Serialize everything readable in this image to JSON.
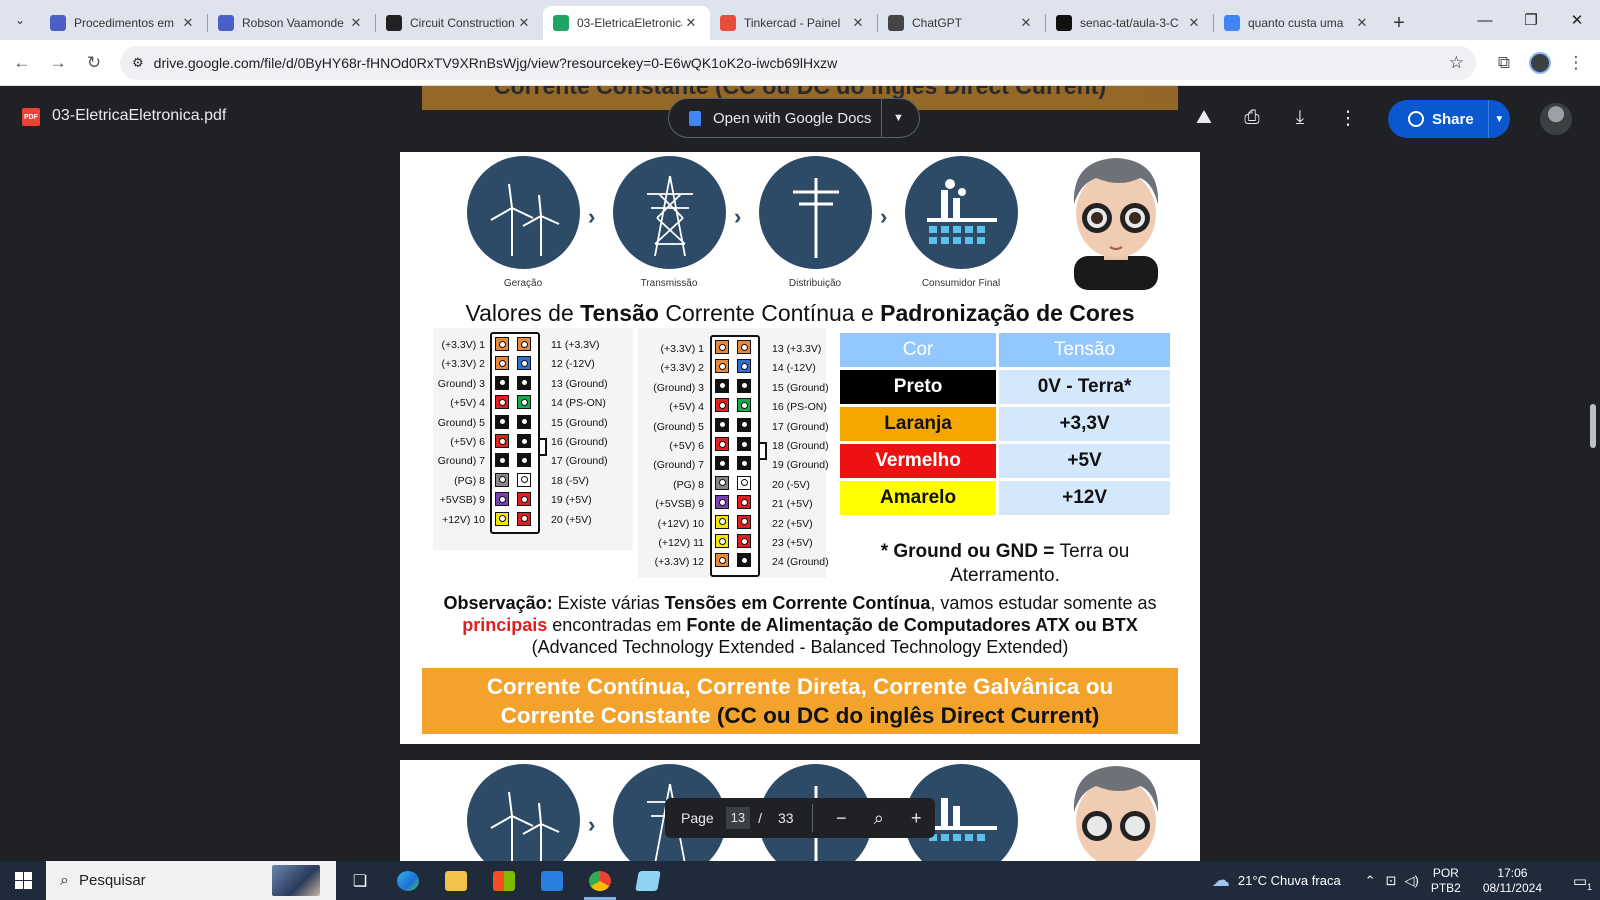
{
  "tabs": [
    {
      "title": "Procedimentos em",
      "icon": "google-forms-icon",
      "color": "#4b5fc9",
      "active": false
    },
    {
      "title": "Robson Vaamonde",
      "icon": "google-forms-icon",
      "color": "#4b5fc9",
      "active": false
    },
    {
      "title": "Circuit Construction",
      "icon": "phet-icon",
      "color": "#222222",
      "active": false
    },
    {
      "title": "03-EletricaEletronica",
      "icon": "google-drive-icon",
      "color": "#1fa463",
      "active": true
    },
    {
      "title": "Tinkercad - Painel",
      "icon": "tinkercad-icon",
      "color": "#e84d3d",
      "active": false
    },
    {
      "title": "ChatGPT",
      "icon": "chatgpt-icon",
      "color": "#444444",
      "active": false
    },
    {
      "title": "senac-tat/aula-3-C",
      "icon": "github-icon",
      "color": "#111111",
      "active": false
    },
    {
      "title": "quanto custa uma",
      "icon": "google-search-icon",
      "color": "#4285f4",
      "active": false
    }
  ],
  "url": "drive.google.com/file/d/0ByHY68r-fHNOd0RxTV9XRnBsWjg/view?resourcekey=0-E6wQK1oK2o-iwcb69lHxzw",
  "viewer": {
    "filename": "03-EletricaEletronica.pdf",
    "open_with": "Open with Google Docs",
    "share": "Share",
    "page_label": "Page",
    "page_current": "13",
    "page_sep": "/",
    "page_total": "33"
  },
  "pdf": {
    "prev_band": "Corrente Constante (CC ou DC do inglês Direct Current)",
    "icons": [
      {
        "label": "Geração",
        "icon": "wind-turbine-icon"
      },
      {
        "label": "Transmissão",
        "icon": "transmission-tower-icon"
      },
      {
        "label": "Distribuição",
        "icon": "utility-pole-icon"
      },
      {
        "label": "Consumidor Final",
        "icon": "factory-icon"
      }
    ],
    "title_1": "Valores de ",
    "title_2": "Tensão",
    "title_3": " Corrente Contínua e ",
    "title_4": "Padronização de Cores",
    "pins20_left": [
      "(+3.3V)  1",
      "(+3.3V)  2",
      "Ground)  3",
      "(+5V)  4",
      "Ground)  5",
      "(+5V)  6",
      "Ground)  7",
      "(PG)  8",
      "+5VSB)  9",
      "+12V)  10"
    ],
    "pins20_right": [
      "11  (+3.3V)",
      "12  (-12V)",
      "13  (Ground)",
      "14  (PS-ON)",
      "15  (Ground)",
      "16  (Ground)",
      "17  (Ground)",
      "18  (-5V)",
      "19  (+5V)",
      "20  (+5V)"
    ],
    "pins24_left": [
      "(+3.3V)  1",
      "(+3.3V)  2",
      "(Ground)  3",
      "(+5V)  4",
      "(Ground)  5",
      "(+5V)  6",
      "(Ground)  7",
      "(PG)  8",
      "(+5VSB)  9",
      "(+12V)  10",
      "(+12V)  11",
      "(+3.3V)  12"
    ],
    "pins24_right": [
      "13  (+3.3V)",
      "14  (-12V)",
      "15  (Ground)",
      "16  (PS-ON)",
      "17  (Ground)",
      "18  (Ground)",
      "19  (Ground)",
      "20  (-5V)",
      "21  (+5V)",
      "22  (+5V)",
      "23  (+5V)",
      "24  (Ground)"
    ],
    "pin20_colors_left": [
      "#e8883a",
      "#e8883a",
      "#111111",
      "#e02020",
      "#111111",
      "#e02020",
      "#111111",
      "#888888",
      "#7a3fb0",
      "#f2e600"
    ],
    "pin20_colors_right": [
      "#e8883a",
      "#2f6fd0",
      "#111111",
      "#19a84a",
      "#111111",
      "#111111",
      "#111111",
      "#ffffff",
      "#e02020",
      "#e02020"
    ],
    "pin24_colors_left": [
      "#e8883a",
      "#e8883a",
      "#111111",
      "#e02020",
      "#111111",
      "#e02020",
      "#111111",
      "#888888",
      "#7a3fb0",
      "#f2e600",
      "#f2e600",
      "#e8883a"
    ],
    "pin24_colors_right": [
      "#e8883a",
      "#2f6fd0",
      "#111111",
      "#19a84a",
      "#111111",
      "#111111",
      "#111111",
      "#ffffff",
      "#e02020",
      "#e02020",
      "#e02020",
      "#111111"
    ],
    "table_head": [
      "Cor",
      "Tensão"
    ],
    "table_rows": [
      {
        "cor": "Preto",
        "tensao": "0V - Terra*",
        "bg": "#000000",
        "fg": "#ffffff"
      },
      {
        "cor": "Laranja",
        "tensao": "+3,3V",
        "bg": "#f5a700",
        "fg": "#111111"
      },
      {
        "cor": "Vermelho",
        "tensao": "+5V",
        "bg": "#ee1111",
        "fg": "#ffffff"
      },
      {
        "cor": "Amarelo",
        "tensao": "+12V",
        "bg": "#ffff00",
        "fg": "#111111"
      }
    ],
    "gnd_1": "* Ground ou GND = ",
    "gnd_2": "Terra ou Aterramento.",
    "obs_1": "Observação:",
    "obs_2": " Existe várias ",
    "obs_3": "Tensões em Corrente Contínua",
    "obs_4": ", vamos estudar somente as ",
    "obs_5": "principais",
    "obs_6": " encontradas em ",
    "obs_7": "Fonte de Alimentação de Computadores ATX ou BTX",
    "obs_8": "(Advanced Technology Extended - Balanced Technology Extended)",
    "band_1": "Corrente Contínua, Corrente Direta, Corrente Galvânica ou",
    "band_2": "Corrente Constante ",
    "band_3": "(CC ou DC do inglês Direct Current)"
  },
  "taskbar": {
    "search": "Pesquisar",
    "weather": "21°C  Chuva fraca",
    "lang_1": "POR",
    "lang_2": "PTB2",
    "time": "17:06",
    "date": "08/11/2024",
    "notif_count": "1"
  }
}
